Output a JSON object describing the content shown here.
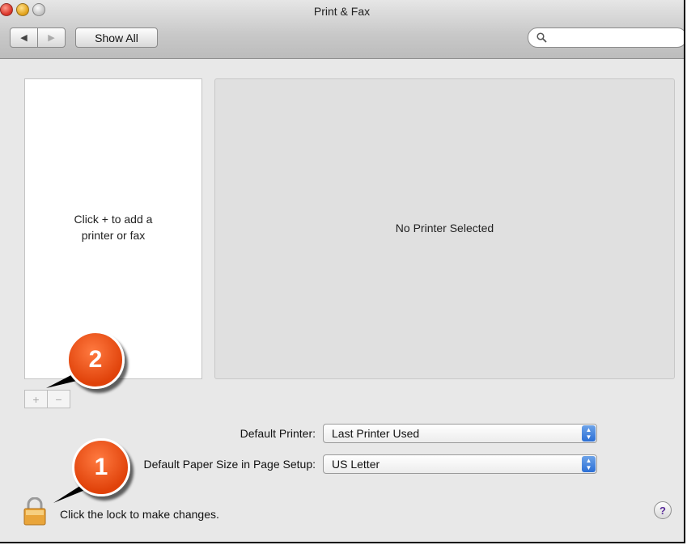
{
  "window": {
    "title": "Print & Fax"
  },
  "toolbar": {
    "back_glyph": "◀",
    "forward_glyph": "▶",
    "show_all_label": "Show All",
    "search_placeholder": ""
  },
  "printers": {
    "empty_hint_line1": "Click + to add a",
    "empty_hint_line2": "printer or fax"
  },
  "detail": {
    "no_selection_text": "No Printer Selected"
  },
  "list_controls": {
    "add_glyph": "+",
    "remove_glyph": "−"
  },
  "settings": {
    "default_printer": {
      "label": "Default Printer:",
      "value": "Last Printer Used"
    },
    "paper_size": {
      "label": "Default Paper Size in Page Setup:",
      "value": "US Letter"
    }
  },
  "footer": {
    "lock_text": "Click the lock to make changes.",
    "help_glyph": "?"
  },
  "callouts": [
    {
      "number": "1"
    },
    {
      "number": "2"
    }
  ],
  "colors": {
    "callout": "#e0420a",
    "popup_arrow": "#2b6fd6"
  }
}
